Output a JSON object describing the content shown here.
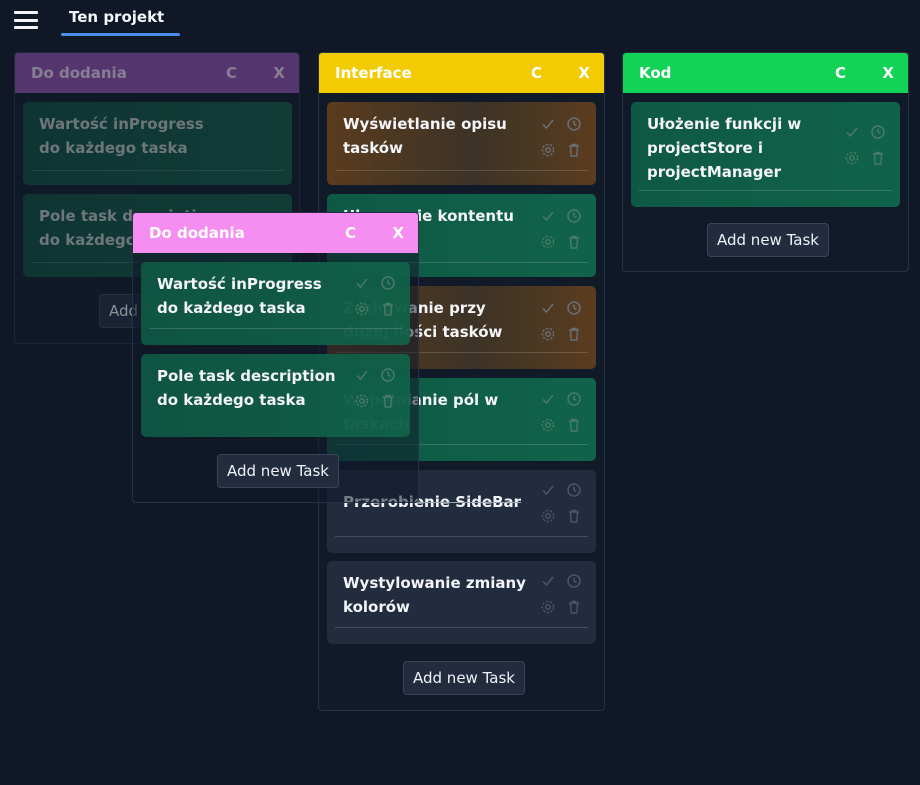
{
  "header": {
    "menu_icon": "hamburger-icon",
    "tab_label": "Ten projekt",
    "accent": "#4a8ee8"
  },
  "columns": [
    {
      "title": "Do dodania",
      "color": "#9b59b6",
      "clear_label": "C",
      "close_label": "X",
      "tasks": [
        {
          "title": "Wartość inProgress do każdego taska"
        },
        {
          "title": "Pole task description do każdego taska"
        }
      ],
      "add_label": "Add new Task"
    },
    {
      "title": "Interface",
      "color": "#f2cb05",
      "clear_label": "C",
      "close_label": "X",
      "tasks": [
        {
          "title": "Wyświetlanie opisu tasków"
        },
        {
          "title": "Ukrywanie kontentu w"
        },
        {
          "title": "Zachowanie przy dużej ilości tasków"
        },
        {
          "title": "Wypełnianie pól w taskach"
        },
        {
          "title": "Przerobienie SideBar"
        },
        {
          "title": "Wystylowanie zmiany kolorów"
        }
      ],
      "add_label": "Add new Task"
    },
    {
      "title": "Kod",
      "color": "#13d357",
      "clear_label": "C",
      "close_label": "X",
      "tasks": [
        {
          "title": "Ułożenie funkcji w projectStore i projectManager"
        }
      ],
      "add_label": "Add new Task"
    }
  ],
  "dragged_column": {
    "title": "Do dodania",
    "color": "#f58ef0",
    "clear_label": "C",
    "close_label": "X",
    "tasks": [
      {
        "title": "Wartość inProgress do każdego taska"
      },
      {
        "title": "Pole task description do każdego taska"
      }
    ],
    "add_label": "Add new Task"
  },
  "task_icons": [
    "check-icon",
    "clock-icon",
    "gear-icon",
    "trash-icon"
  ]
}
